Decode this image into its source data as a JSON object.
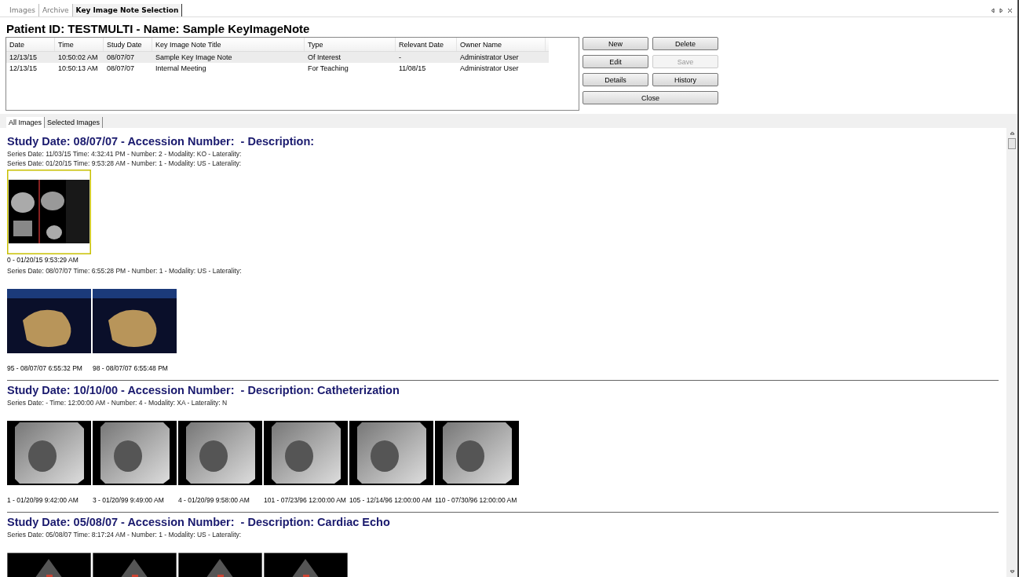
{
  "tabs": [
    {
      "label": "Images",
      "selected": false
    },
    {
      "label": "Archive",
      "selected": false
    },
    {
      "label": "Key Image Note Selection",
      "selected": true
    }
  ],
  "patient_header": "Patient ID: TESTMULTI - Name: Sample KeyImageNote",
  "table": {
    "columns": [
      "Date",
      "Time",
      "Study Date",
      "Key Image Note Title",
      "Type",
      "Relevant Date",
      "Owner Name"
    ],
    "rows": [
      {
        "cells": [
          "12/13/15",
          "10:50:02 AM",
          "08/07/07",
          "Sample Key Image Note",
          "Of Interest",
          "-",
          "Administrator User"
        ],
        "selected": true
      },
      {
        "cells": [
          "12/13/15",
          "10:50:13 AM",
          "08/07/07",
          "Internal Meeting",
          "For Teaching",
          "11/08/15",
          "Administrator User"
        ],
        "selected": false
      }
    ]
  },
  "buttons": [
    {
      "label": "New",
      "disabled": false
    },
    {
      "label": "Delete",
      "disabled": false
    },
    {
      "label": "Edit",
      "disabled": false
    },
    {
      "label": "Save",
      "disabled": true
    },
    {
      "label": "Details",
      "disabled": false
    },
    {
      "label": "History",
      "disabled": false
    },
    {
      "label": "Close",
      "disabled": false
    }
  ],
  "image_tabs": [
    {
      "label": "All Images",
      "selected": true
    },
    {
      "label": "Selected Images",
      "selected": false
    }
  ],
  "studies": [
    {
      "heading": "Study Date: 08/07/07 - Accession Number:  - Description:",
      "series": [
        {
          "info": "Series Date: 11/03/15 Time: 4:32:41 PM - Number: 2 - Modality: KO - Laterality:"
        },
        {
          "info": "Series Date: 01/20/15 Time: 9:53:28 AM - Number: 1 - Modality: US - Laterality:",
          "images": [
            {
              "kind": "grid",
              "caption": "0 - 01/20/15 9:53:29 AM",
              "selected": true
            }
          ]
        },
        {
          "info": "Series Date: 08/07/07 Time: 6:55:28 PM - Number: 1 - Modality: US - Laterality:",
          "images": [
            {
              "kind": "volume",
              "caption": "95 - 08/07/07 6:55:32 PM",
              "selected": false
            },
            {
              "kind": "volume",
              "caption": "98 - 08/07/07 6:55:48 PM",
              "selected": false
            }
          ]
        }
      ]
    },
    {
      "heading": "Study Date: 10/10/00 - Accession Number:  - Description: Catheterization",
      "series": [
        {
          "info": "Series Date: - Time: 12:00:00 AM - Number: 4 - Modality: XA - Laterality: N",
          "images": [
            {
              "kind": "xray",
              "caption": "1 - 01/20/99 9:42:00 AM",
              "selected": false
            },
            {
              "kind": "xray",
              "caption": "3 - 01/20/99 9:49:00 AM",
              "selected": false
            },
            {
              "kind": "xray",
              "caption": "4 - 01/20/99 9:58:00 AM",
              "selected": false
            },
            {
              "kind": "xray",
              "caption": "101 - 07/23/96 12:00:00 AM",
              "selected": false
            },
            {
              "kind": "xray",
              "caption": "105 - 12/14/96 12:00:00 AM",
              "selected": false
            },
            {
              "kind": "xray",
              "caption": "110 - 07/30/96 12:00:00 AM",
              "selected": false
            }
          ]
        }
      ]
    },
    {
      "heading": "Study Date: 05/08/07 - Accession Number:  - Description: Cardiac Echo",
      "series": [
        {
          "info": "Series Date: 05/08/07 Time: 8:17:24 AM - Number: 1 - Modality: US - Laterality:",
          "images": [
            {
              "kind": "doppler",
              "selected": false
            },
            {
              "kind": "doppler",
              "selected": false
            },
            {
              "kind": "doppler",
              "selected": false
            },
            {
              "kind": "doppler",
              "selected": false
            }
          ]
        }
      ]
    }
  ]
}
